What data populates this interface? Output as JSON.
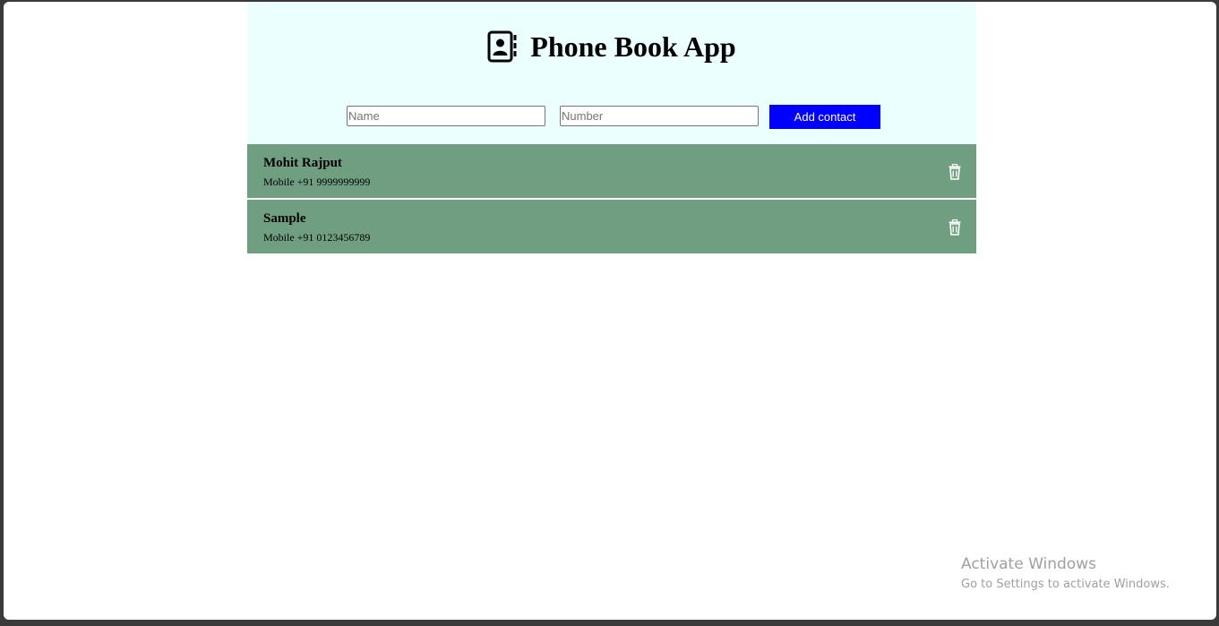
{
  "app": {
    "title": "Phone Book App",
    "title_icon": "contact-book-icon"
  },
  "form": {
    "name_placeholder": "Name",
    "name_value": "",
    "number_placeholder": "Number",
    "number_value": "",
    "add_label": "Add contact"
  },
  "contacts": [
    {
      "name": "Mohit Rajput",
      "number": "Mobile +91 9999999999"
    },
    {
      "name": "Sample",
      "number": "Mobile +91 0123456789"
    }
  ],
  "watermark": {
    "title": "Activate Windows",
    "subtitle": "Go to Settings to activate Windows."
  },
  "colors": {
    "header_bg": "#ebffff",
    "contact_bg": "#709e80",
    "button_bg": "#0000ff"
  }
}
